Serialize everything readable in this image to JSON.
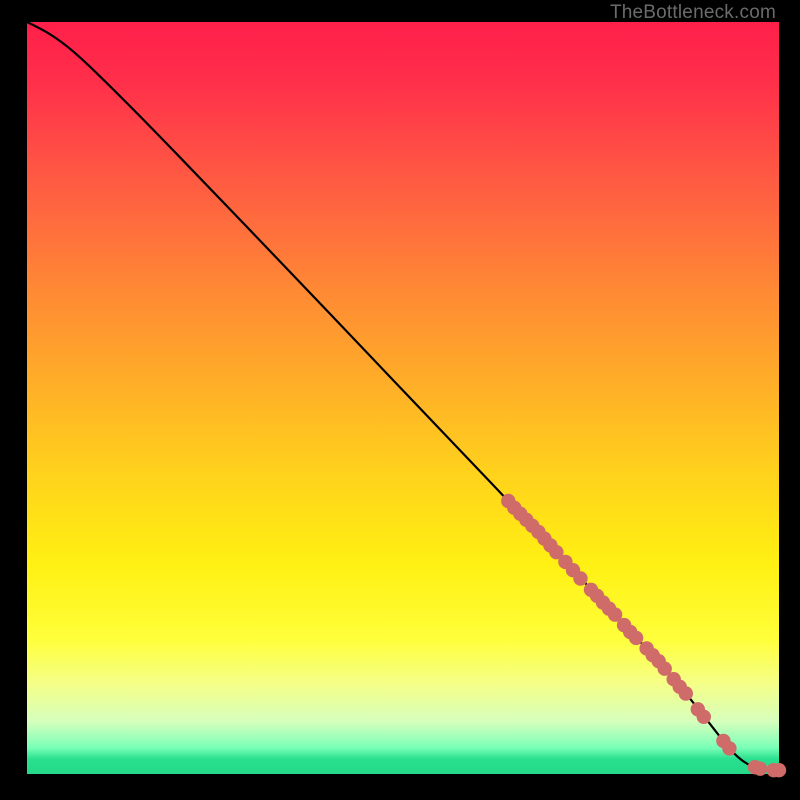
{
  "watermark": "TheBottleneck.com",
  "colors": {
    "marker": "#cf6b68",
    "curve": "#000000"
  },
  "chart_data": {
    "type": "line",
    "title": "",
    "xlabel": "",
    "ylabel": "",
    "xlim": [
      0,
      100
    ],
    "ylim": [
      0,
      100
    ],
    "grid": false,
    "legend": false,
    "curve_points": [
      {
        "x": 0,
        "y": 100
      },
      {
        "x": 3,
        "y": 98.5
      },
      {
        "x": 6,
        "y": 96.3
      },
      {
        "x": 10,
        "y": 92.5
      },
      {
        "x": 16,
        "y": 86.5
      },
      {
        "x": 24,
        "y": 78.2
      },
      {
        "x": 34,
        "y": 67.8
      },
      {
        "x": 46,
        "y": 55.2
      },
      {
        "x": 58,
        "y": 42.6
      },
      {
        "x": 64,
        "y": 36.3
      },
      {
        "x": 70,
        "y": 29.9
      },
      {
        "x": 76,
        "y": 23.5
      },
      {
        "x": 82,
        "y": 17.1
      },
      {
        "x": 86,
        "y": 12.7
      },
      {
        "x": 89,
        "y": 9.0
      },
      {
        "x": 91.5,
        "y": 5.8
      },
      {
        "x": 93.5,
        "y": 3.2
      },
      {
        "x": 95.5,
        "y": 1.4
      },
      {
        "x": 97.5,
        "y": 0.6
      },
      {
        "x": 99.2,
        "y": 0.5
      },
      {
        "x": 100,
        "y": 0.5
      }
    ],
    "markers": [
      {
        "x": 64.0,
        "y": 36.3
      },
      {
        "x": 64.8,
        "y": 35.4
      },
      {
        "x": 65.6,
        "y": 34.6
      },
      {
        "x": 66.4,
        "y": 33.8
      },
      {
        "x": 67.2,
        "y": 33.0
      },
      {
        "x": 68.0,
        "y": 32.2
      },
      {
        "x": 68.8,
        "y": 31.3
      },
      {
        "x": 69.6,
        "y": 30.4
      },
      {
        "x": 70.4,
        "y": 29.5
      },
      {
        "x": 71.6,
        "y": 28.2
      },
      {
        "x": 72.6,
        "y": 27.1
      },
      {
        "x": 73.6,
        "y": 26.0
      },
      {
        "x": 75.0,
        "y": 24.5
      },
      {
        "x": 75.8,
        "y": 23.7
      },
      {
        "x": 76.6,
        "y": 22.8
      },
      {
        "x": 77.4,
        "y": 22.0
      },
      {
        "x": 78.2,
        "y": 21.2
      },
      {
        "x": 79.4,
        "y": 19.8
      },
      {
        "x": 80.2,
        "y": 18.9
      },
      {
        "x": 81.0,
        "y": 18.1
      },
      {
        "x": 82.4,
        "y": 16.7
      },
      {
        "x": 83.2,
        "y": 15.8
      },
      {
        "x": 84.0,
        "y": 15.0
      },
      {
        "x": 84.8,
        "y": 14.0
      },
      {
        "x": 86.0,
        "y": 12.6
      },
      {
        "x": 86.8,
        "y": 11.6
      },
      {
        "x": 87.6,
        "y": 10.7
      },
      {
        "x": 89.2,
        "y": 8.6
      },
      {
        "x": 90.0,
        "y": 7.6
      },
      {
        "x": 92.6,
        "y": 4.4
      },
      {
        "x": 93.4,
        "y": 3.4
      },
      {
        "x": 96.8,
        "y": 0.9
      },
      {
        "x": 97.5,
        "y": 0.7
      },
      {
        "x": 99.3,
        "y": 0.5
      },
      {
        "x": 100.0,
        "y": 0.5
      }
    ]
  }
}
